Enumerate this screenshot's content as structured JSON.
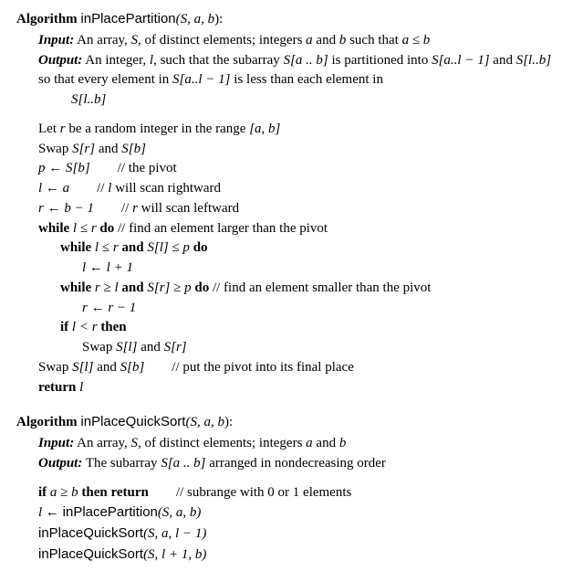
{
  "algo1": {
    "kw_algorithm": "Algorithm",
    "name": "inPlacePartition",
    "sig_open": "(",
    "sig_S": "S",
    "sig_c1": ", ",
    "sig_a": "a",
    "sig_c2": ", ",
    "sig_b": "b",
    "sig_close": "):",
    "input_label": "Input:",
    "input_text1": " An array, ",
    "input_S": "S",
    "input_text2": ", of distinct elements; integers ",
    "input_a": "a",
    "input_text3": " and ",
    "input_b": "b",
    "input_text4": " such that ",
    "input_rel": "a ≤ b",
    "output_label": "Output:",
    "output_text1": " An integer, ",
    "output_l": "l",
    "output_text2": ", such that the subarray ",
    "output_Sab": "S[a .. b]",
    "output_text3": " is partitioned into ",
    "output_Sal": "S[a..l − 1]",
    "output_text4": " and ",
    "output_Slb": "S[l..b]",
    "output_text5": " so that every element in ",
    "output_Sal2": "S[a..l − 1]",
    "output_text6": " is less than each element in ",
    "output_Slb2": "S[l..b]",
    "l1a": "Let ",
    "l1_r": "r",
    "l1b": " be a random integer in the range ",
    "l1c": "[a, b]",
    "l2a": "Swap ",
    "l2b": "S[r]",
    "l2c": " and ",
    "l2d": "S[b]",
    "l3a": "p ← S[b]",
    "l3_comment": "// the pivot",
    "l4a": "l ← a",
    "l4_comment": "// ",
    "l4_l": "l",
    "l4_comment2": " will scan rightward",
    "l5a": "r ← b − 1",
    "l5_comment": "// ",
    "l5_r": "r",
    "l5_comment2": " will scan leftward",
    "kw_while": "while ",
    "l6a": " l ≤ r ",
    "kw_do": "do",
    "l6_comment": "   // find an element larger than the pivot",
    "l7a": " l ≤ r ",
    "kw_and": "and",
    "l7b": " S[l] ≤ p ",
    "l8a": "l ← l + 1",
    "l9a": " r ≥ l ",
    "l9b": " S[r] ≥ p ",
    "l9_comment": "   // find an element smaller than the pivot",
    "l10a": "r ← r − 1",
    "kw_if": "if ",
    "l11a": " l < r ",
    "kw_then": "then",
    "l12a": "Swap ",
    "l12b": "S[l]",
    "l12c": " and ",
    "l12d": "S[r]",
    "l13a": "Swap ",
    "l13b": "S[l]",
    "l13c": " and ",
    "l13d": "S[b]",
    "l13_comment": "// put the pivot into its final place",
    "kw_return": "return ",
    "l14a": "l"
  },
  "algo2": {
    "kw_algorithm": "Algorithm",
    "name": "inPlaceQuickSort",
    "sig_open": "(",
    "sig_S": "S",
    "sig_c1": ", ",
    "sig_a": "a",
    "sig_c2": ", ",
    "sig_b": "b",
    "sig_close": "):",
    "input_label": "Input:",
    "input_text1": " An array, ",
    "input_S": "S",
    "input_text2": ", of distinct elements; integers ",
    "input_a": "a",
    "input_text3": " and ",
    "input_b": "b",
    "output_label": "Output:",
    "output_text1": " The subarray ",
    "output_Sab": "S[a .. b]",
    "output_text2": " arranged in nondecreasing order",
    "kw_if": "if ",
    "l1a": " a ≥ b ",
    "kw_then_return": "then return",
    "l1_comment": "// subrange with 0 or 1 elements",
    "l2a": "l ← ",
    "l2_name": "inPlacePartition",
    "l2b": "(S, a, b)",
    "l3_name": "inPlaceQuickSort",
    "l3a": "(S, a, l − 1)",
    "l4_name": "inPlaceQuickSort",
    "l4a": "(S, l + 1, b)"
  }
}
